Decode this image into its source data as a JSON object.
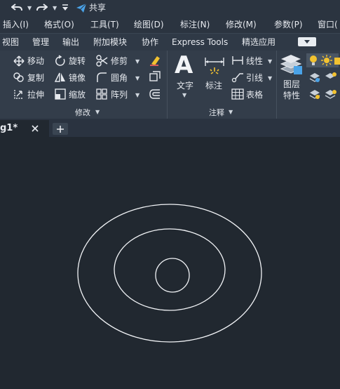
{
  "qat": {
    "share_label": "共享"
  },
  "menubar": {
    "items": [
      {
        "label": "插入(I)"
      },
      {
        "label": "格式(O)"
      },
      {
        "label": "工具(T)"
      },
      {
        "label": "绘图(D)"
      },
      {
        "label": "标注(N)"
      },
      {
        "label": "修改(M)"
      },
      {
        "label": "参数(P)"
      },
      {
        "label": "窗口("
      }
    ]
  },
  "ribbon_tabs": [
    {
      "label": "视图"
    },
    {
      "label": "管理"
    },
    {
      "label": "输出"
    },
    {
      "label": "附加模块"
    },
    {
      "label": "协作"
    },
    {
      "label": "Express Tools"
    },
    {
      "label": "精选应用"
    }
  ],
  "modify_panel": {
    "title": "修改",
    "tools": {
      "move": "移动",
      "rotate": "旋转",
      "trim": "修剪",
      "copy": "复制",
      "mirror": "镜像",
      "fillet": "圆角",
      "stretch": "拉伸",
      "scale": "缩放",
      "array": "阵列"
    }
  },
  "annotation_panel": {
    "title": "注释",
    "text": "文字",
    "dimension": "标注",
    "linear": "线性",
    "leader": "引线",
    "table": "表格"
  },
  "layers_panel": {
    "properties_line1": "图层",
    "properties_line2": "特性"
  },
  "document_tab": {
    "title": "g1*"
  },
  "colors": {
    "canvas": "#212830",
    "ribbon": "#333d4a",
    "accent_yellow": "#f2c230",
    "share_blue": "#4aa3e8"
  }
}
